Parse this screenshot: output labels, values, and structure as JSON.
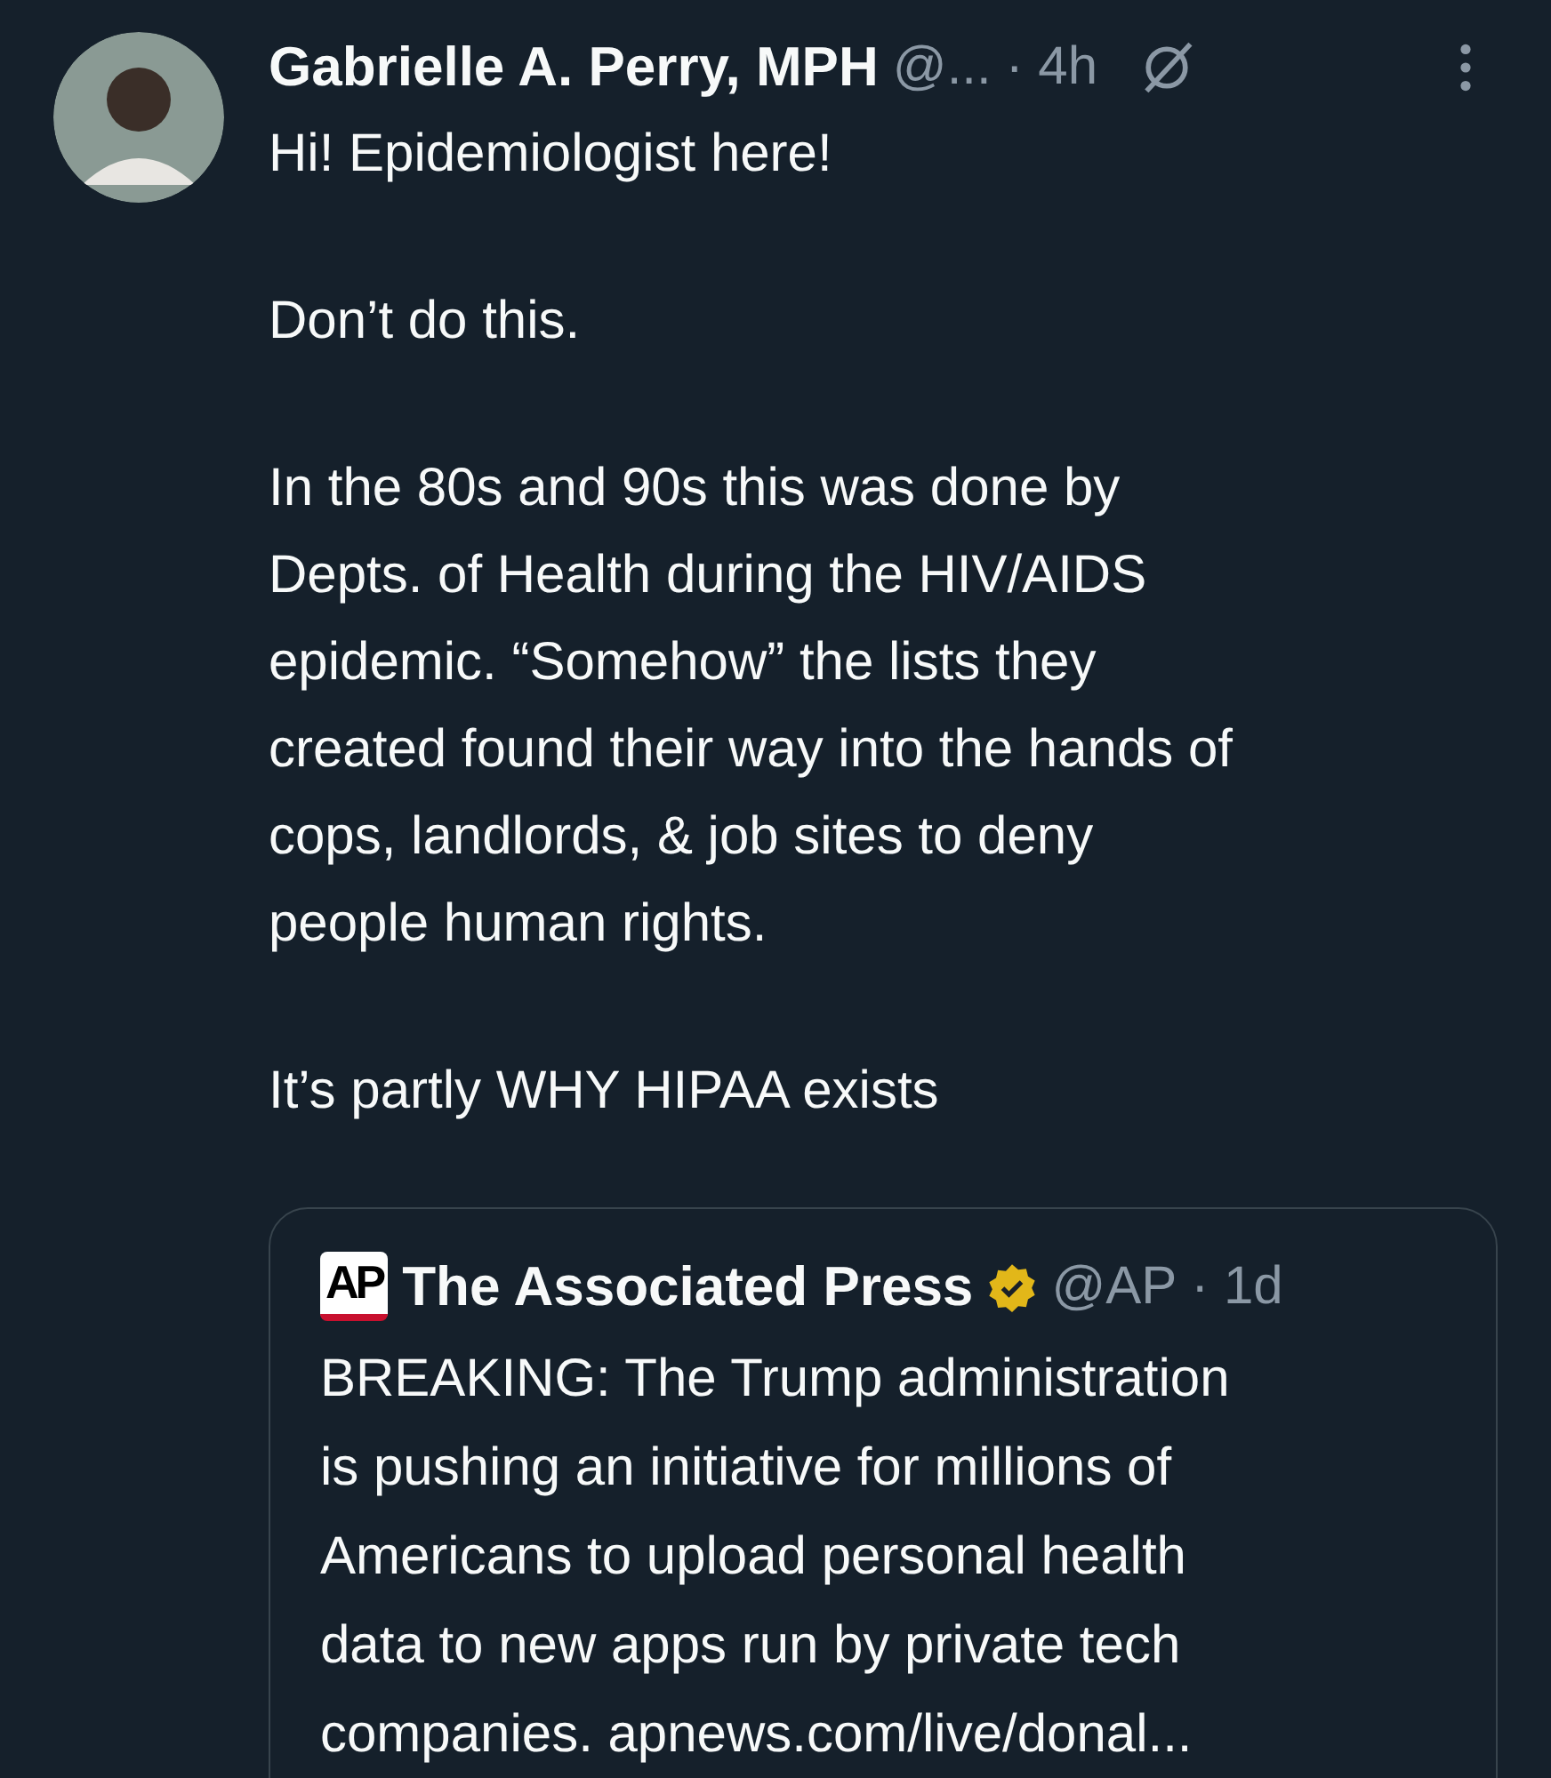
{
  "post": {
    "author": "Gabrielle A. Perry, MPH",
    "handle": "@...",
    "time": "· 4h",
    "paragraphs": [
      "Hi! Epidemiologist here!",
      "Don’t do this.",
      "In the 80s and 90s this was done by\nDepts. of Health during the HIV/AIDS\nepidemic. “Somehow” the lists they\ncreated found their way into the hands of\ncops, landlords, & job sites to deny\npeople human rights.",
      "It’s partly WHY HIPAA exists"
    ]
  },
  "quote": {
    "logo": "AP",
    "author": "The Associated Press",
    "verified": true,
    "handle": "@AP",
    "time": "· 1d",
    "text": "BREAKING: The Trump administration\nis pushing an initiative for millions of\nAmericans to upload personal health\ndata to new apps run by private tech\ncompanies. apnews.com/live/donal..."
  }
}
